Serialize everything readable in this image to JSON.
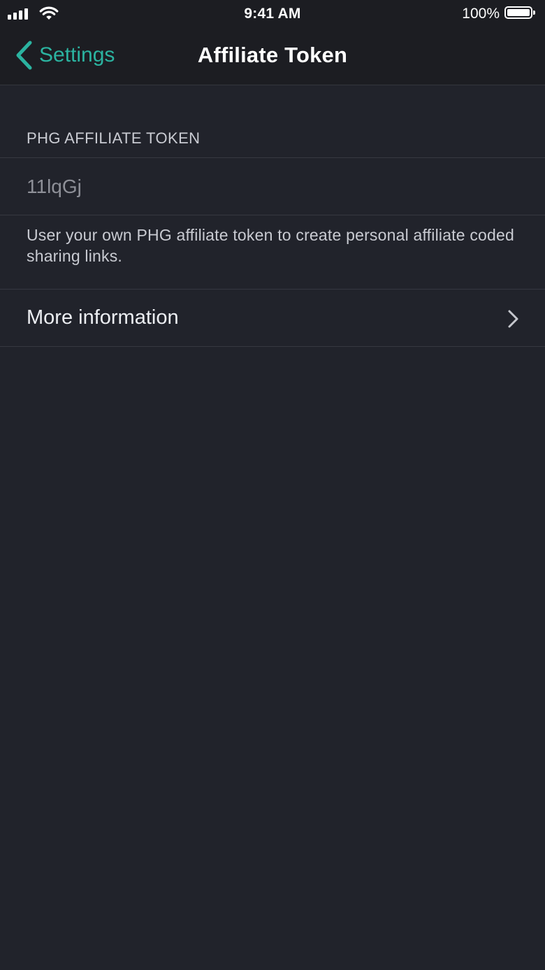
{
  "status_bar": {
    "time": "9:41 AM",
    "battery_percent": "100%",
    "battery_level": 1.0,
    "signal_bars": 4,
    "icons": [
      "cellular-signal-icon",
      "wifi-icon",
      "battery-icon"
    ]
  },
  "nav": {
    "back_label": "Settings",
    "title": "Affiliate Token"
  },
  "section": {
    "header": "PHG AFFILIATE TOKEN",
    "token_value": "11lqGj",
    "footer": "User your own PHG affiliate token to create personal affiliate coded sharing links."
  },
  "more_info": {
    "label": "More information"
  },
  "colors": {
    "accent": "#2bb3a0",
    "background": "#21232b",
    "nav_background": "#1c1d22",
    "separator": "#363841",
    "secondary_text": "#c9cbd2",
    "input_text": "#8e9098"
  }
}
